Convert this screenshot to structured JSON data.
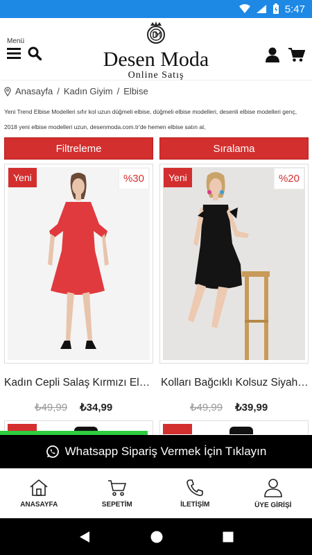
{
  "status_bar": {
    "time": "5:47"
  },
  "header": {
    "menu_label": "Menü",
    "logo_title": "Desen Moda",
    "logo_subtitle": "Online Satış"
  },
  "breadcrumb": [
    "Anasayfa",
    "Kadın Giyim",
    "Elbise"
  ],
  "description": "Yeni Trend Elbise Modelleri sıfır kol uzun düğmeli elbise, düğmeli elbise modelleri, desenli elbise modelleri genç, 2018 yeni elbise modelleri uzun, desenmoda.com.tr'de hemen elbise satın al,",
  "controls": {
    "filter_label": "Filtreleme",
    "sort_label": "Sıralama"
  },
  "products": [
    {
      "badge": "Yeni",
      "discount": "%30",
      "name": "Kadın Cepli Salaş Kırmızı Elbise",
      "old_price": "₺49,99",
      "price": "₺34,99"
    },
    {
      "badge": "Yeni",
      "discount": "%20",
      "name": "Kolları Bağcıklı Kolsuz Siyah Elbise",
      "old_price": "₺49,99",
      "price": "₺39,99"
    }
  ],
  "whatsapp": {
    "label": "Whatsapp Sipariş Vermek İçin Tıklayın"
  },
  "bottom_nav": [
    {
      "label": "ANASAYFA",
      "icon": "home-icon"
    },
    {
      "label": "SEPETİM",
      "icon": "cart-icon"
    },
    {
      "label": "İLETİŞİM",
      "icon": "phone-icon"
    },
    {
      "label": "ÜYE GİRİŞİ",
      "icon": "user-icon"
    }
  ],
  "colors": {
    "accent": "#d32f2f",
    "status_bar": "#1e88e5",
    "whatsapp_green": "#2ecc40"
  }
}
